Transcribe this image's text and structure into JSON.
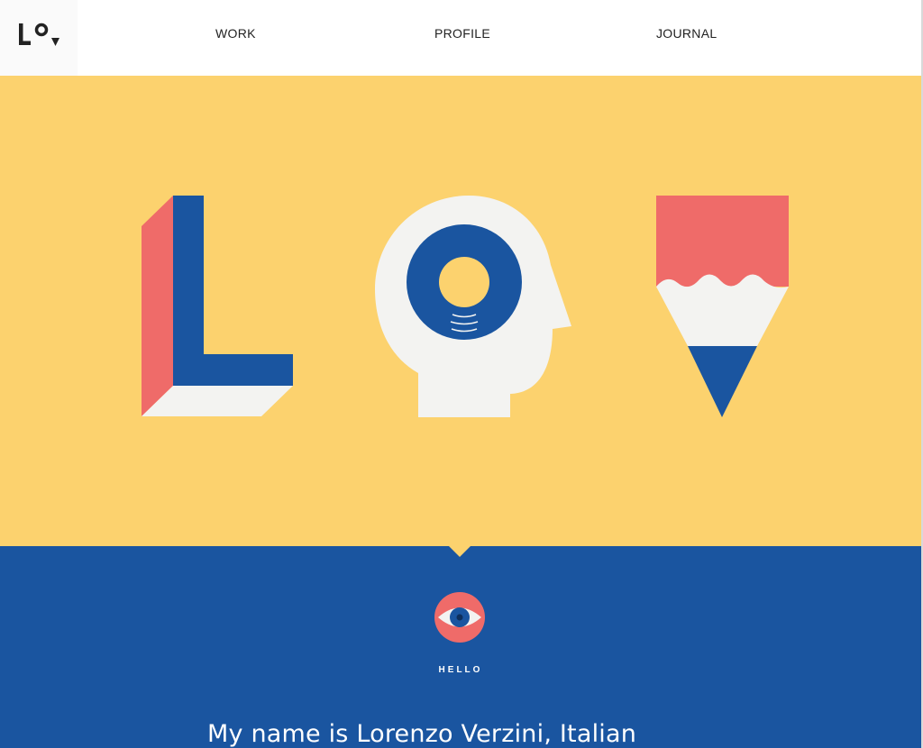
{
  "nav": {
    "logo_alt": "Lo logo",
    "links": [
      "WORK",
      "PROFILE",
      "JOURNAL"
    ]
  },
  "hero": {
    "illustrations": [
      "letter-l-3d-icon",
      "head-with-eye-icon",
      "pencil-icon"
    ]
  },
  "intro": {
    "section_label": "HELLO",
    "heading": "My name is Lorenzo Verzini, Italian",
    "icon": "eye-icon"
  },
  "colors": {
    "yellow": "#fcd26e",
    "blue": "#1a55a0",
    "coral": "#ef6b69",
    "off_white": "#f3f3f1",
    "text_dark": "#222222"
  }
}
